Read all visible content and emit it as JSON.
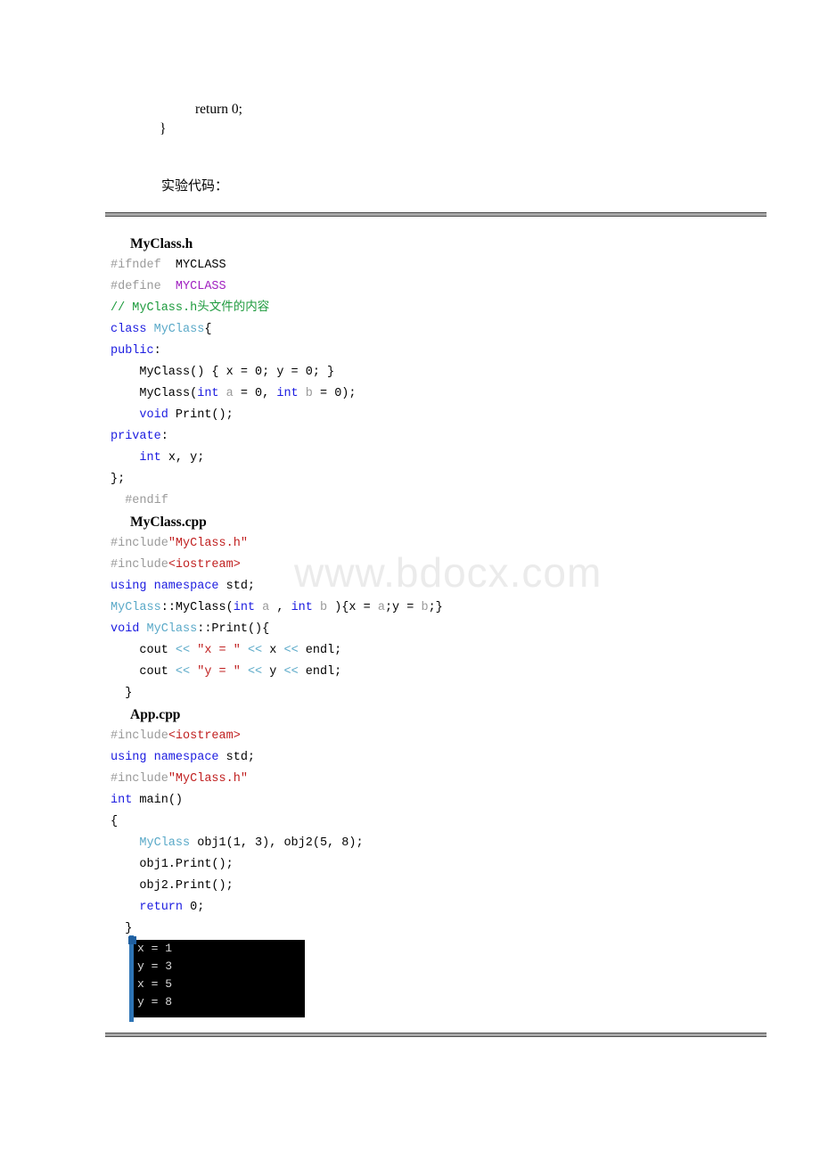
{
  "document": {
    "watermark": "www.bdocx.com",
    "prose": {
      "return_line": "return 0;",
      "close_brace": "}",
      "section_label": "实验代码："
    }
  },
  "code": {
    "files": [
      {
        "heading": "MyClass.h",
        "lines": [
          [
            {
              "t": "#ifndef",
              "c": "pre"
            },
            {
              "t": "  MYCLASS",
              "c": "plain"
            }
          ],
          [
            {
              "t": "#define",
              "c": "pre"
            },
            {
              "t": "  ",
              "c": "plain"
            },
            {
              "t": "MYCLASS",
              "c": "macro"
            }
          ],
          [
            {
              "t": "// MyClass.h头文件的内容",
              "c": "com"
            }
          ],
          [
            {
              "t": "class ",
              "c": "kw"
            },
            {
              "t": "MyClass",
              "c": "type"
            },
            {
              "t": "{",
              "c": "plain"
            }
          ],
          [
            {
              "t": "public",
              "c": "kw"
            },
            {
              "t": ":",
              "c": "plain"
            }
          ],
          [
            {
              "t": "    MyClass() { x = 0; y = 0; }",
              "c": "plain"
            }
          ],
          [
            {
              "t": "    MyClass(",
              "c": "plain"
            },
            {
              "t": "int",
              "c": "kw"
            },
            {
              "t": " ",
              "c": "plain"
            },
            {
              "t": "a",
              "c": "var"
            },
            {
              "t": " = 0, ",
              "c": "plain"
            },
            {
              "t": "int",
              "c": "kw"
            },
            {
              "t": " ",
              "c": "plain"
            },
            {
              "t": "b",
              "c": "var"
            },
            {
              "t": " = 0);",
              "c": "plain"
            }
          ],
          [
            {
              "t": "    ",
              "c": "plain"
            },
            {
              "t": "void",
              "c": "kw"
            },
            {
              "t": " Print();",
              "c": "plain"
            }
          ],
          [
            {
              "t": "private",
              "c": "kw"
            },
            {
              "t": ":",
              "c": "plain"
            }
          ],
          [
            {
              "t": "    ",
              "c": "plain"
            },
            {
              "t": "int",
              "c": "kw"
            },
            {
              "t": " x, y;",
              "c": "plain"
            }
          ],
          [
            {
              "t": "};",
              "c": "plain"
            }
          ],
          [
            {
              "t": "  #endif",
              "c": "pre"
            }
          ]
        ]
      },
      {
        "heading": "MyClass.cpp",
        "lines": [
          [
            {
              "t": "#include",
              "c": "pre"
            },
            {
              "t": "\"MyClass.h\"",
              "c": "str"
            }
          ],
          [
            {
              "t": "#include",
              "c": "pre"
            },
            {
              "t": "<iostream>",
              "c": "str"
            }
          ],
          [
            {
              "t": "using namespace",
              "c": "kw"
            },
            {
              "t": " std;",
              "c": "plain"
            }
          ],
          [
            {
              "t": "MyClass",
              "c": "type"
            },
            {
              "t": "::MyClass(",
              "c": "plain"
            },
            {
              "t": "int",
              "c": "kw"
            },
            {
              "t": " ",
              "c": "plain"
            },
            {
              "t": "a",
              "c": "var"
            },
            {
              "t": " , ",
              "c": "plain"
            },
            {
              "t": "int",
              "c": "kw"
            },
            {
              "t": " ",
              "c": "plain"
            },
            {
              "t": "b",
              "c": "var"
            },
            {
              "t": " ){x = ",
              "c": "plain"
            },
            {
              "t": "a",
              "c": "var"
            },
            {
              "t": ";y = ",
              "c": "plain"
            },
            {
              "t": "b",
              "c": "var"
            },
            {
              "t": ";}",
              "c": "plain"
            }
          ],
          [
            {
              "t": "void",
              "c": "kw"
            },
            {
              "t": " ",
              "c": "plain"
            },
            {
              "t": "MyClass",
              "c": "type"
            },
            {
              "t": "::Print(){",
              "c": "plain"
            }
          ],
          [
            {
              "t": "    cout ",
              "c": "plain"
            },
            {
              "t": "<<",
              "c": "op"
            },
            {
              "t": " ",
              "c": "plain"
            },
            {
              "t": "\"x = \"",
              "c": "str"
            },
            {
              "t": " ",
              "c": "plain"
            },
            {
              "t": "<<",
              "c": "op"
            },
            {
              "t": " x ",
              "c": "plain"
            },
            {
              "t": "<<",
              "c": "op"
            },
            {
              "t": " endl;",
              "c": "plain"
            }
          ],
          [
            {
              "t": "    cout ",
              "c": "plain"
            },
            {
              "t": "<<",
              "c": "op"
            },
            {
              "t": " ",
              "c": "plain"
            },
            {
              "t": "\"y = \"",
              "c": "str"
            },
            {
              "t": " ",
              "c": "plain"
            },
            {
              "t": "<<",
              "c": "op"
            },
            {
              "t": " y ",
              "c": "plain"
            },
            {
              "t": "<<",
              "c": "op"
            },
            {
              "t": " endl;",
              "c": "plain"
            }
          ],
          [
            {
              "t": "  }",
              "c": "plain"
            }
          ]
        ]
      },
      {
        "heading": "App.cpp",
        "lines": [
          [
            {
              "t": "#include",
              "c": "pre"
            },
            {
              "t": "<iostream>",
              "c": "str"
            }
          ],
          [
            {
              "t": "using namespace",
              "c": "kw"
            },
            {
              "t": " std;",
              "c": "plain"
            }
          ],
          [
            {
              "t": "#include",
              "c": "pre"
            },
            {
              "t": "\"MyClass.h\"",
              "c": "str"
            }
          ],
          [
            {
              "t": "int",
              "c": "kw"
            },
            {
              "t": " main()",
              "c": "plain"
            }
          ],
          [
            {
              "t": "{",
              "c": "plain"
            }
          ],
          [
            {
              "t": "    ",
              "c": "plain"
            },
            {
              "t": "MyClass",
              "c": "type"
            },
            {
              "t": " obj1(1, 3), obj2(5, 8);",
              "c": "plain"
            }
          ],
          [
            {
              "t": "    obj1.Print();",
              "c": "plain"
            }
          ],
          [
            {
              "t": "    obj2.Print();",
              "c": "plain"
            }
          ],
          [
            {
              "t": "    ",
              "c": "plain"
            },
            {
              "t": "return",
              "c": "kw"
            },
            {
              "t": " 0;",
              "c": "plain"
            }
          ],
          [
            {
              "t": "  }",
              "c": "plain"
            }
          ]
        ]
      }
    ]
  },
  "console": {
    "lines": [
      "x = 1",
      "y = 3",
      "x = 5",
      "y = 8"
    ]
  },
  "colors": {
    "keyword": "#1c1ce0",
    "type": "#5aa9c8",
    "string": "#c02020",
    "comment": "#1c9a3c",
    "preprocessor": "#9a9a9a",
    "macro": "#a020c0",
    "console_bg": "#000000",
    "console_fg": "#d8d8d8",
    "selection_bar": "#2e74b5"
  }
}
